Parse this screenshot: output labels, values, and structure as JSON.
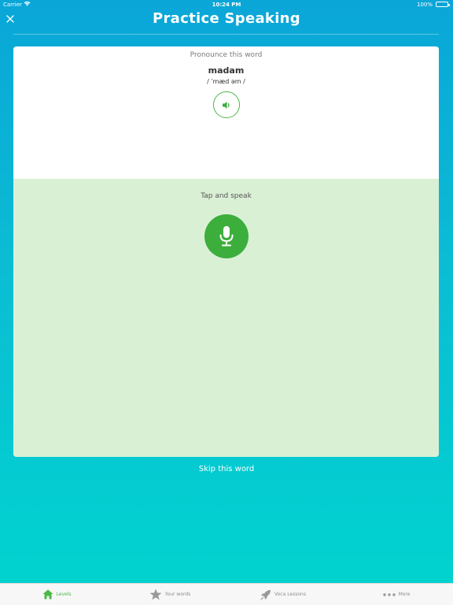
{
  "status_bar": {
    "carrier": "Carrier",
    "time": "10:24 PM",
    "battery": "100%"
  },
  "nav": {
    "title": "Practice Speaking",
    "close_icon": "close-icon"
  },
  "word_card": {
    "prompt": "Pronounce this word",
    "word": "madam",
    "phonetic": "/ ˈmæd əm /",
    "audio_icon": "speaker-icon"
  },
  "speak_card": {
    "prompt": "Tap and speak",
    "mic_icon": "microphone-icon"
  },
  "skip_label": "Skip this word",
  "tab_bar": {
    "items": [
      {
        "label": "Levels",
        "icon": "home-icon",
        "active": true
      },
      {
        "label": "Your words",
        "icon": "star-icon",
        "active": false
      },
      {
        "label": "Voca Lessons",
        "icon": "rocket-icon",
        "active": false
      },
      {
        "label": "More",
        "icon": "more-dots-icon",
        "active": false
      }
    ]
  },
  "colors": {
    "accent_green": "#3cae3c",
    "speak_panel_bg": "#daf0d5",
    "background_top": "#0aa6d8",
    "background_bottom": "#00d4cf"
  }
}
